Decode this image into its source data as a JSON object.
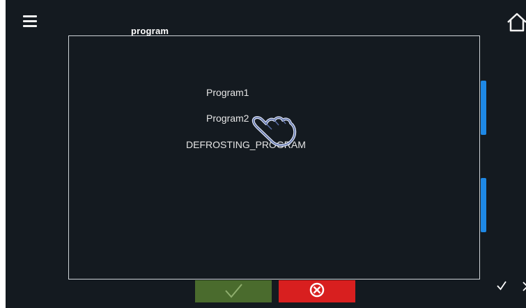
{
  "dialog": {
    "title": "program",
    "options": [
      {
        "label": "Program1"
      },
      {
        "label": "Program2"
      },
      {
        "label": "DEFROSTING_PROGRAM"
      }
    ]
  },
  "icons": {
    "menu": "hamburger-menu-icon",
    "home": "home-icon",
    "confirm": "checkmark-icon",
    "cancel": "close-icon",
    "pointer": "pointing-hand-icon"
  },
  "colors": {
    "background": "#141a20",
    "accent_blue": "#1e88e5",
    "confirm_green": "#4a6b2d",
    "cancel_red": "#d81f1f"
  }
}
